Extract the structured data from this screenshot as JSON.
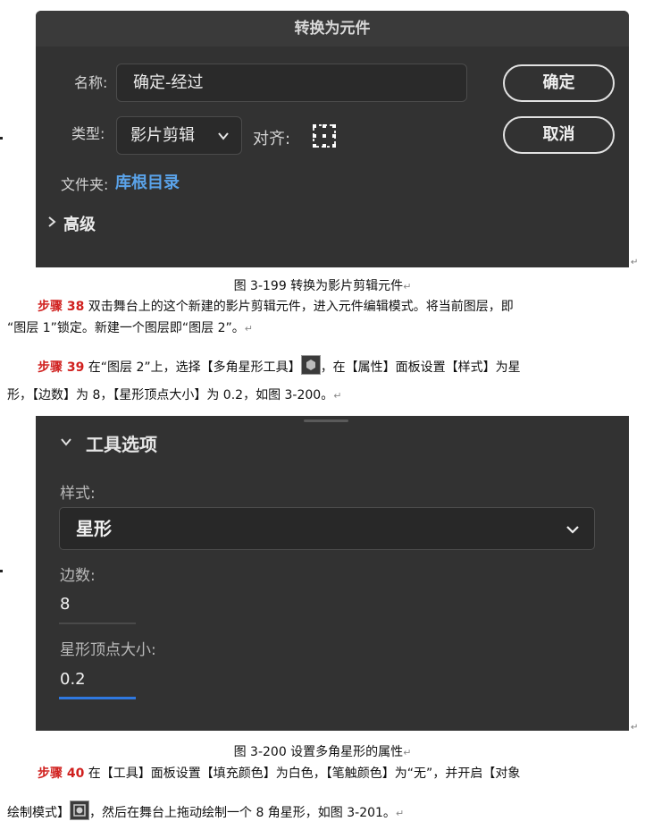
{
  "dialog1": {
    "title": "转换为元件",
    "name_label": "名称:",
    "name_value": "确定-经过",
    "type_label": "类型:",
    "type_value": "影片剪辑",
    "align_label": "对齐:",
    "folder_label": "文件夹:",
    "folder_value": "库根目录",
    "advanced_label": "高级",
    "ok_button": "确定",
    "cancel_button": "取消"
  },
  "caption1": "图 3-199  转换为影片剪辑元件",
  "step38": {
    "label": "步骤 38",
    "text1": "  双击舞台上的这个新建的影片剪辑元件，进入元件编辑模式。将当前图层，即",
    "text2": "“图层 1”锁定。新建一个图层即“图层 2”。"
  },
  "step39": {
    "label": "步骤 39",
    "text1": " 在“图层 2”上，选择【多角星形工具】",
    "text2": "，在【属性】面板设置【样式】为星",
    "text3": "形，【边数】为 8，【星形顶点大小】为 0.2，如图 3-200。"
  },
  "panel2": {
    "title": "工具选项",
    "style_label": "样式:",
    "style_value": "星形",
    "sides_label": "边数:",
    "sides_value": "8",
    "star_label": "星形顶点大小:",
    "star_value": "0.2"
  },
  "caption2": "图 3-200  设置多角星形的属性",
  "step40": {
    "label": "步骤 40",
    "text1": "  在【工具】面板设置【填充颜色】为白色，【笔触颜色】为“无”，并开启【对象",
    "text2": "绘制模式】",
    "text3": "，然后在舞台上拖动绘制一个 8 角星形，如图 3-201。"
  },
  "return_mark": "↵",
  "colors": {
    "panel_bg": "#323232",
    "link_blue": "#5aa3ea",
    "step_red": "#d0201e",
    "active_underline": "#2f78e0"
  }
}
